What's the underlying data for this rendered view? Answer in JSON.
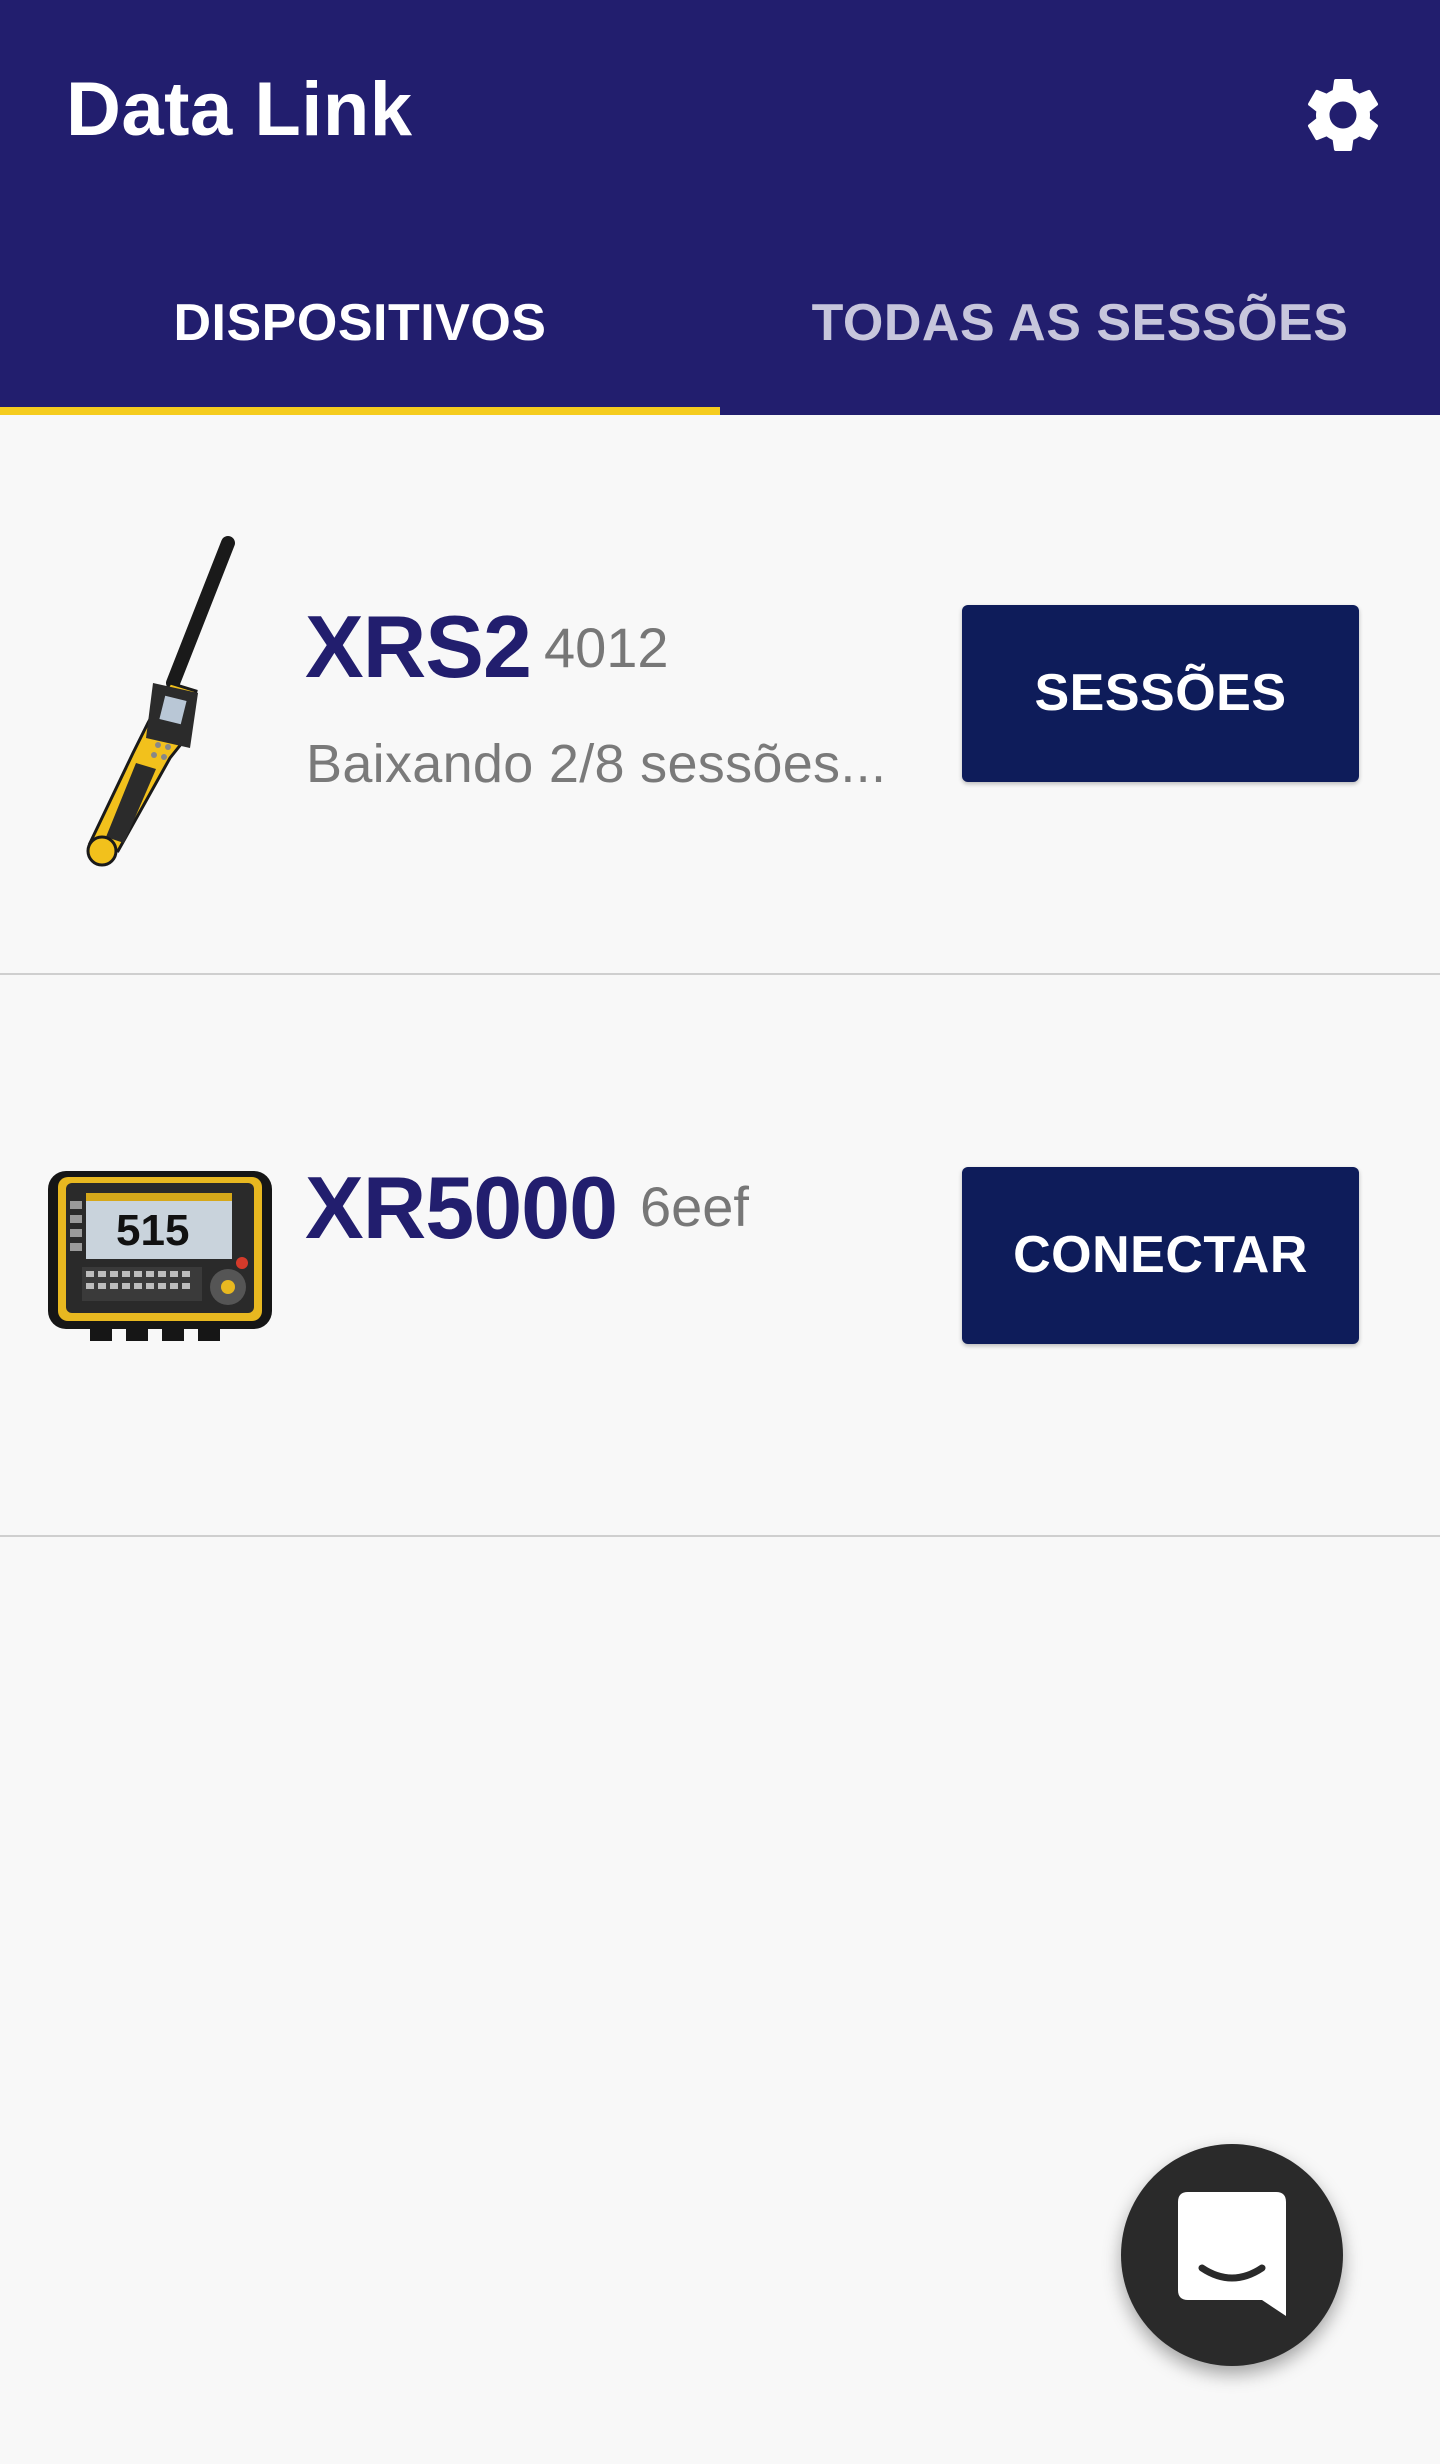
{
  "app": {
    "title": "Data Link",
    "icons": {
      "settings": "gear-icon",
      "chat": "chat-icon"
    },
    "colors": {
      "primary": "#221e6e",
      "tab_indicator": "#f5cc1f",
      "button": "#0e1c5a",
      "background": "#f8f8f8"
    }
  },
  "tabs": [
    {
      "label": "DISPOSITIVOS",
      "selected": true
    },
    {
      "label": "TODAS AS SESSÕES",
      "selected": false
    }
  ],
  "devices": [
    {
      "name": "XRS2",
      "id": "4012",
      "status": "Baixando 2/8 sessões...",
      "action_label": "SESSÕES"
    },
    {
      "name": "XR5000",
      "id": "6eef",
      "status": "",
      "action_label": "CONECTAR",
      "screen_reading": "515"
    }
  ]
}
